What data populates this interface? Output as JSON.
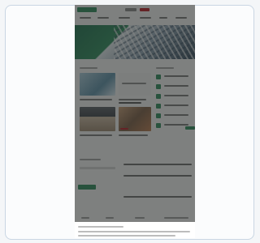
{
  "screen": {
    "background": "#f4f6f8",
    "card_border": "#c9d6e3",
    "brand_green": "#2f8a5c",
    "brand_red": "#b71f27",
    "overlay": "rgba(35,40,38,0.56)"
  },
  "page": {
    "logo_text": "",
    "nav_items": [
      "",
      "",
      "",
      "",
      "",
      ""
    ],
    "hero_alt": "",
    "section_left_title": "",
    "section_right_title": "",
    "articles": [
      {
        "label": ""
      },
      {
        "label": ""
      },
      {
        "label": ""
      },
      {
        "label": ""
      }
    ],
    "sidebar_items": [
      {
        "label": ""
      },
      {
        "label": ""
      },
      {
        "label": ""
      },
      {
        "label": ""
      },
      {
        "label": ""
      },
      {
        "label": ""
      }
    ],
    "form_title": "",
    "form_subtitle": "",
    "form_button": "",
    "cookie_text": "",
    "cookie_buttons": [
      "",
      "",
      ""
    ]
  }
}
